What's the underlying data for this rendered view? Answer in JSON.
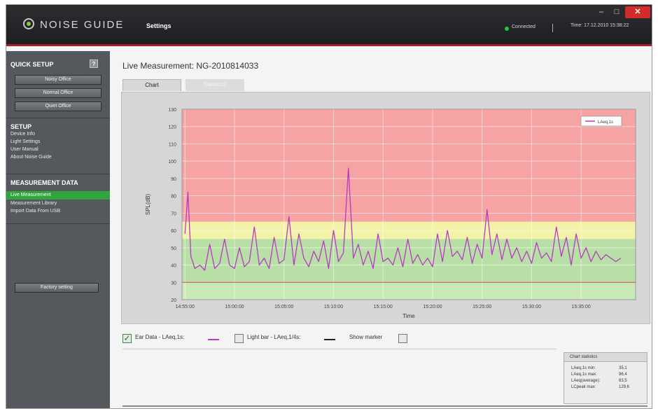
{
  "titlebar": {
    "app_name": "NOISE GUIDE",
    "section": "Settings",
    "status": "Connected",
    "time": "Time: 17.12.2010 15:38:22"
  },
  "window_controls": {
    "minimize": "–",
    "maximize": "□",
    "close": "✕"
  },
  "sidebar": {
    "quick_setup": {
      "heading": "QUICK SETUP",
      "help": "?",
      "presets": [
        "Noisy Office",
        "Normal Office",
        "Quiet Office"
      ]
    },
    "setup": {
      "heading": "SETUP",
      "items": [
        "Device Info",
        "Light Settings",
        "User Manual",
        "About Noise Guide"
      ]
    },
    "measurement": {
      "heading": "MEASUREMENT DATA",
      "items": [
        "Live Measurement",
        "Measurement Library",
        "Import Data From USB"
      ],
      "active": "Live Measurement"
    },
    "factory_button": "Factory setting"
  },
  "main": {
    "title": "Live Measurement: NG-2010814033",
    "tabs": [
      "Chart",
      "Statistics"
    ],
    "active_tab": "Chart"
  },
  "chart_data": {
    "type": "line",
    "xlabel": "Time",
    "ylabel": "SPL(dB)",
    "ylim": [
      20,
      130
    ],
    "yticks": [
      20,
      30,
      40,
      50,
      60,
      70,
      80,
      90,
      100,
      110,
      120,
      130
    ],
    "xticks": [
      "14:55:00",
      "15:00:00",
      "15:05:00",
      "15:10:00",
      "15:15:00",
      "15:20:00",
      "15:25:00",
      "15:30:00",
      "15:35:00"
    ],
    "x_range_minutes": [
      -0.3,
      45.5
    ],
    "zones": [
      {
        "name": "red",
        "from": 65,
        "to": 130,
        "color": "#f5a3a3"
      },
      {
        "name": "yellow",
        "from": 55,
        "to": 65,
        "color": "#f2f2a8"
      },
      {
        "name": "green",
        "from": 30,
        "to": 55,
        "color": "#b8dfa5"
      }
    ],
    "threshold_line": 30,
    "series": [
      {
        "name": "LAeq,1s",
        "color": "#b83ac4",
        "x": [
          0.0,
          0.3,
          0.6,
          1.0,
          1.5,
          2.0,
          2.5,
          3.0,
          3.5,
          4.0,
          4.5,
          5.0,
          5.5,
          6.0,
          6.5,
          7.0,
          7.5,
          8.0,
          8.5,
          9.0,
          9.5,
          10.0,
          10.5,
          11.0,
          11.5,
          12.0,
          12.5,
          13.0,
          13.5,
          14.0,
          14.5,
          15.0,
          15.5,
          16.0,
          16.5,
          17.0,
          17.5,
          18.0,
          18.5,
          19.0,
          19.5,
          20.0,
          20.5,
          21.0,
          21.5,
          22.0,
          22.5,
          23.0,
          23.5,
          24.0,
          24.5,
          25.0,
          25.5,
          26.0,
          26.5,
          27.0,
          27.5,
          28.0,
          28.5,
          29.0,
          29.5,
          30.0,
          30.5,
          31.0,
          31.5,
          32.0,
          32.5,
          33.0,
          33.5,
          34.0,
          34.5,
          35.0,
          35.5,
          36.0,
          36.5,
          37.0,
          37.5,
          38.0,
          38.5,
          39.0,
          39.5,
          40.0,
          40.5,
          41.0,
          41.5,
          42.0,
          42.5,
          43.0,
          43.5,
          44.0
        ],
        "values": [
          58,
          82,
          45,
          38,
          40,
          37,
          52,
          38,
          41,
          55,
          40,
          38,
          50,
          39,
          42,
          62,
          40,
          44,
          38,
          56,
          41,
          43,
          68,
          40,
          58,
          44,
          39,
          48,
          42,
          54,
          38,
          60,
          42,
          47,
          96,
          44,
          52,
          40,
          48,
          38,
          58,
          42,
          44,
          40,
          50,
          39,
          55,
          41,
          46,
          40,
          44,
          39,
          58,
          42,
          60,
          45,
          48,
          43,
          56,
          41,
          52,
          44,
          72,
          46,
          58,
          43,
          55,
          44,
          50,
          42,
          48,
          41,
          53,
          44,
          47,
          42,
          62,
          45,
          56,
          40,
          58,
          44,
          50,
          42,
          48,
          43,
          46,
          44,
          42,
          44
        ]
      }
    ]
  },
  "legend": {
    "ear_data": "Ear Data - LAeq,1s:",
    "light_bar": "Light bar - LAeq,1/4s:",
    "show_marker": "Show marker"
  },
  "stats": {
    "title": "Chart statistics",
    "rows": [
      {
        "label": "LAeq,1s min:",
        "value": "35,1"
      },
      {
        "label": "LAeq,1s max:",
        "value": "96,4"
      },
      {
        "label": "LAeq(average):",
        "value": "63,5"
      },
      {
        "label": "LCpeak max:",
        "value": "129,6"
      }
    ]
  },
  "colors": {
    "titlebar": "#1d1f22",
    "accent_red": "#a61d2b",
    "active_green": "#2fa53b",
    "sidebar": "#55585c",
    "series_purple": "#b83ac4"
  }
}
